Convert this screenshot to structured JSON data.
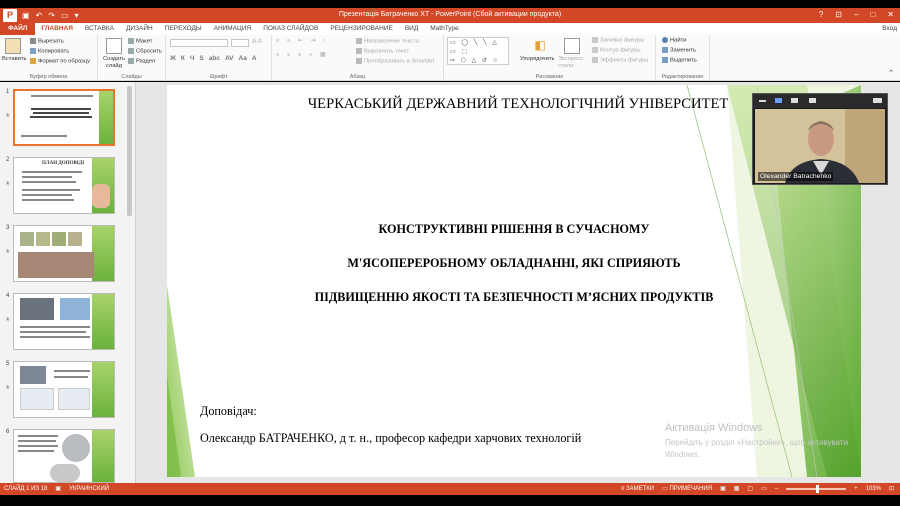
{
  "window": {
    "title": "Презентація Батраченко XT - PowerPoint (Сбой активации продукта)",
    "app_icon_letter": "P",
    "winctl": [
      "?",
      "⊡",
      "–",
      "□",
      "✕"
    ]
  },
  "tabs": {
    "file": "ФАЙЛ",
    "items": [
      "ГЛАВНАЯ",
      "ВСТАВКА",
      "ДИЗАЙН",
      "ПЕРЕХОДЫ",
      "АНИМАЦИЯ",
      "ПОКАЗ СЛАЙДОВ",
      "РЕЦЕНЗИРОВАНИЕ",
      "ВИД",
      "MathType"
    ],
    "active_index": 0,
    "signin": "Вход"
  },
  "ribbon": {
    "clipboard": {
      "paste": "Вставить",
      "cut": "Вырезать",
      "copy": "Копировать",
      "format_painter": "Формат по образцу",
      "label": "Буфер обмена"
    },
    "slides": {
      "new_slide": "Создать слайд",
      "layout": "Макет",
      "reset": "Сбросить",
      "section": "Раздел",
      "label": "Слайды"
    },
    "font": {
      "bold": "Ж",
      "italic": "К",
      "underline": "Ч",
      "shadow": "S",
      "strike": "abc",
      "spacing": "AV",
      "case": "Aa",
      "color": "А",
      "label": "Шрифт"
    },
    "paragraph": {
      "text_direction": "Направление текста",
      "align_text": "Выровнять текст",
      "smartart": "Преобразовать в SmartArt",
      "label": "Абзац"
    },
    "drawing": {
      "arrange": "Упорядочить",
      "quick_styles": "Экспресс-стили",
      "shape_fill": "Заливка фигуры",
      "shape_outline": "Контур фигуры",
      "shape_effects": "Эффекты фигуры",
      "label": "Рисование"
    },
    "editing": {
      "find": "Найти",
      "replace": "Заменить",
      "select": "Выделить",
      "label": "Редактирование"
    }
  },
  "thumbnails": [
    {
      "num": "1",
      "selected": true
    },
    {
      "num": "2",
      "selected": false,
      "title": "ПЛАН ДОПОВІДІ"
    },
    {
      "num": "3",
      "selected": false
    },
    {
      "num": "4",
      "selected": false
    },
    {
      "num": "5",
      "selected": false
    },
    {
      "num": "6",
      "selected": false
    }
  ],
  "slide": {
    "university": "ЧЕРКАСЬКИЙ ДЕРЖАВНИЙ ТЕХНОЛОГІЧНИЙ УНІВЕРСИТЕТ",
    "title_lines": [
      "КОНСТРУКТИВНІ РІШЕННЯ В СУЧАСНОМУ",
      "М'ЯСОПЕРЕРОБНОМУ ОБЛАДНАННІ, ЯКІ СПРИЯЮТЬ",
      "ПІДВИЩЕННЮ ЯКОСТІ ТА БЕЗПЕЧНОСТІ М’ЯСНИХ ПРОДУКТІВ"
    ],
    "speaker_label": "Доповідач:",
    "speaker": "Олександр БАТРАЧЕНКО, д т. н., професор кафедри харчових технологій"
  },
  "activation": {
    "line1": "Активація Windows",
    "line2": "Перейдіть у розділ «Настройки», щоб активувати",
    "line3": "Windows."
  },
  "video": {
    "participant_name": "Olexander Batrachenko"
  },
  "status": {
    "slide_info": "СЛАЙД 1 ИЗ 18",
    "language": "УКРАИНСКИЙ",
    "notes": "ЗАМЕТКИ",
    "comments": "ПРИМЕЧАНИЯ",
    "zoom": "103%"
  },
  "colors": {
    "accent": "#d24726",
    "green_light": "#b5dc7c",
    "green_dark": "#5ba830"
  }
}
